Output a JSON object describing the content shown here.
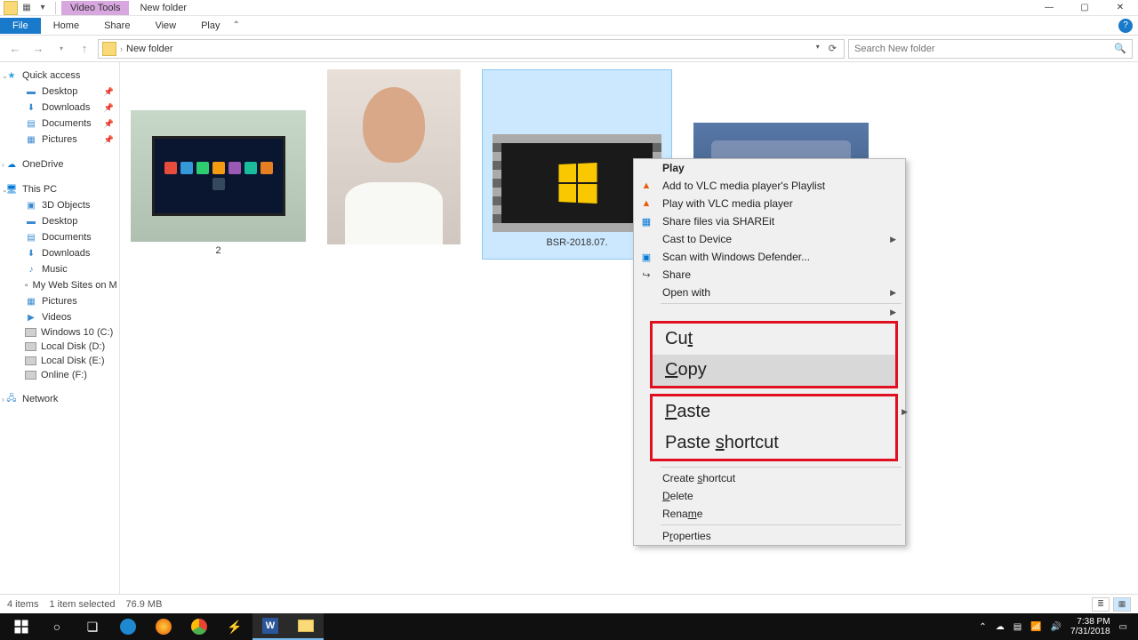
{
  "titlebar": {
    "video_tools": "Video Tools",
    "folder_name": "New folder"
  },
  "ribbon": {
    "file": "File",
    "home": "Home",
    "share": "Share",
    "view": "View",
    "play": "Play"
  },
  "address": {
    "path": "New folder",
    "search_placeholder": "Search New folder"
  },
  "sidebar": {
    "quick_access": "Quick access",
    "desktop": "Desktop",
    "downloads": "Downloads",
    "documents": "Documents",
    "pictures": "Pictures",
    "onedrive": "OneDrive",
    "this_pc": "This PC",
    "objects3d": "3D Objects",
    "desktop2": "Desktop",
    "documents2": "Documents",
    "downloads2": "Downloads",
    "music": "Music",
    "mywebsites": "My Web Sites on M",
    "pictures2": "Pictures",
    "videos": "Videos",
    "win10": "Windows 10 (C:)",
    "locald": "Local Disk (D:)",
    "locale": "Local Disk (E:)",
    "onlinef": "Online (F:)",
    "network": "Network"
  },
  "items": {
    "label1": "2",
    "label_video": "BSR-2018.07."
  },
  "context": {
    "play": "Play",
    "add_vlc": "Add to VLC media player's Playlist",
    "play_vlc": "Play with VLC media player",
    "shareit": "Share files via SHAREit",
    "cast": "Cast to Device",
    "defender": "Scan with Windows Defender...",
    "share": "Share",
    "openwith": "Open with",
    "cut": "Cut",
    "copy": "Copy",
    "paste": "Paste",
    "paste_shortcut": "Paste shortcut",
    "create_shortcut": "Create shortcut",
    "delete": "Delete",
    "rename": "Rename",
    "properties": "Properties"
  },
  "status": {
    "count": "4 items",
    "selected": "1 item selected",
    "size": "76.9 MB"
  },
  "clock": {
    "time": "7:38 PM",
    "date": "7/31/2018"
  }
}
